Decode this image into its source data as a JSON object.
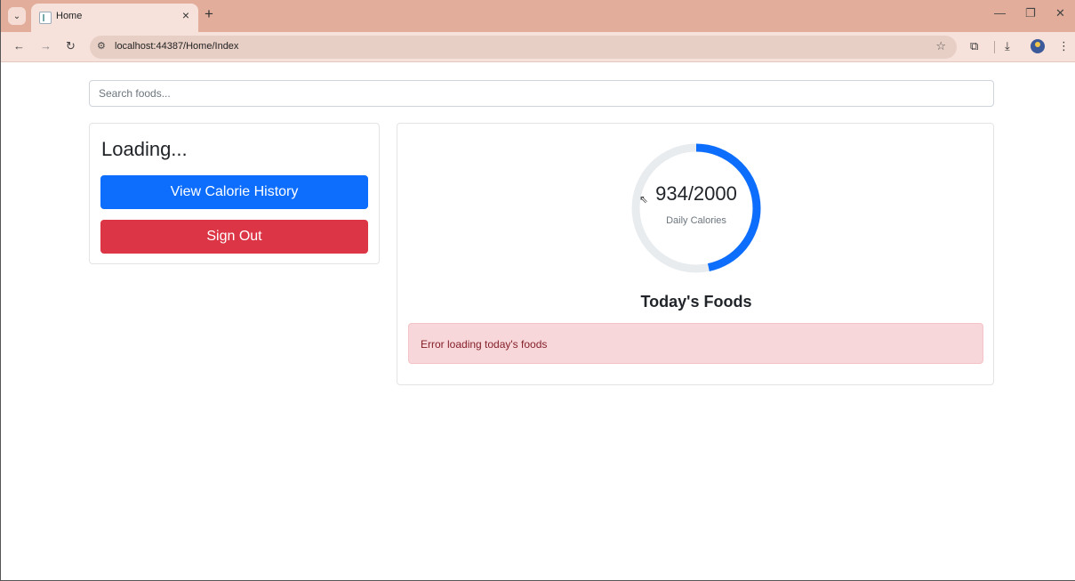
{
  "browser": {
    "tab_title": "Home",
    "url": "localhost:44387/Home/Index",
    "new_tab_symbol": "+",
    "tab_close_symbol": "×"
  },
  "search": {
    "placeholder": "Search foods..."
  },
  "sidebar": {
    "heading": "Loading...",
    "history_button_label": "View Calorie History",
    "signout_button_label": "Sign Out"
  },
  "calories": {
    "value_text": "934/2000",
    "consumed": 934,
    "goal": 2000,
    "label": "Daily Calories"
  },
  "foods": {
    "title": "Today's Foods",
    "error_message": "Error loading today's foods"
  },
  "colors": {
    "primary": "#0d6efd",
    "danger": "#dc3545",
    "ring_track": "#e9ecef",
    "alert_bg": "#f8d7da",
    "browser_chrome": "#e2ad9b"
  }
}
